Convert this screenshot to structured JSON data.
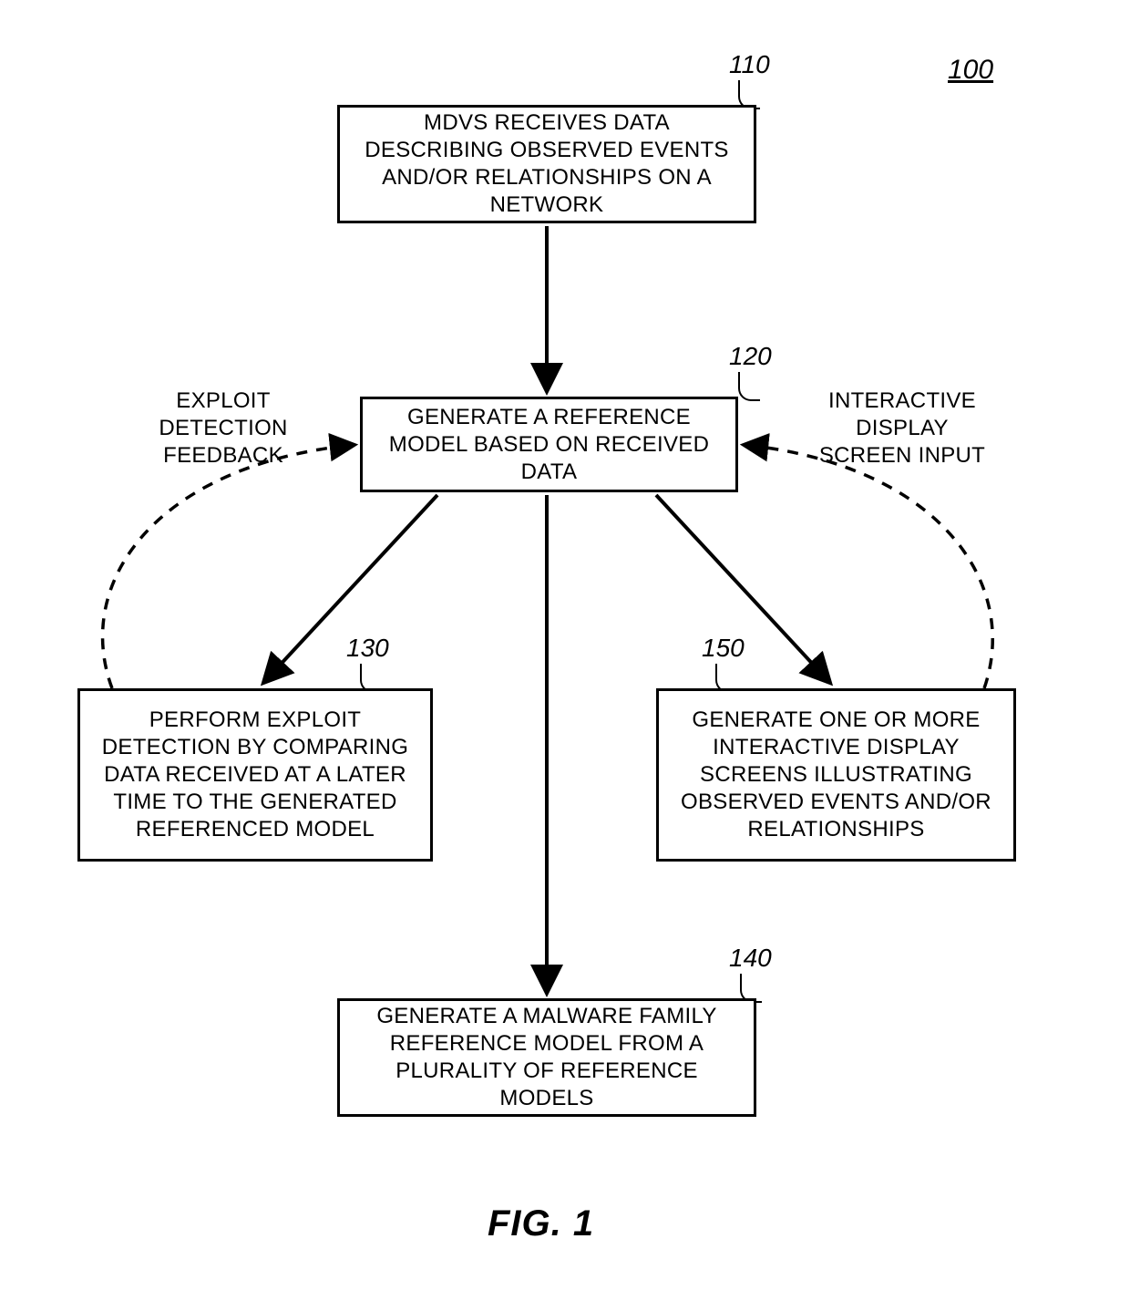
{
  "page_ref": "100",
  "figure_title": "FIG. 1",
  "feedback_left": "EXPLOIT DETECTION FEEDBACK",
  "feedback_right": "INTERACTIVE DISPLAY SCREEN INPUT",
  "boxes": {
    "b110": {
      "ref": "110",
      "text": "MDVS RECEIVES DATA DESCRIBING OBSERVED EVENTS AND/OR RELATIONSHIPS ON A NETWORK"
    },
    "b120": {
      "ref": "120",
      "text": "GENERATE A REFERENCE MODEL BASED ON RECEIVED DATA"
    },
    "b130": {
      "ref": "130",
      "text": "PERFORM EXPLOIT DETECTION BY COMPARING DATA RECEIVED AT A LATER TIME TO THE GENERATED REFERENCED MODEL"
    },
    "b140": {
      "ref": "140",
      "text": "GENERATE A MALWARE FAMILY REFERENCE MODEL FROM A PLURALITY OF REFERENCE MODELS"
    },
    "b150": {
      "ref": "150",
      "text": "GENERATE ONE OR MORE INTERACTIVE DISPLAY SCREENS ILLUSTRATING OBSERVED EVENTS AND/OR RELATIONSHIPS"
    }
  },
  "chart_data": {
    "type": "flowchart",
    "nodes": [
      {
        "id": "110",
        "label": "MDVS RECEIVES DATA DESCRIBING OBSERVED EVENTS AND/OR RELATIONSHIPS ON A NETWORK"
      },
      {
        "id": "120",
        "label": "GENERATE A REFERENCE MODEL BASED ON RECEIVED DATA"
      },
      {
        "id": "130",
        "label": "PERFORM EXPLOIT DETECTION BY COMPARING DATA RECEIVED AT A LATER TIME TO THE GENERATED REFERENCED MODEL"
      },
      {
        "id": "140",
        "label": "GENERATE A MALWARE FAMILY REFERENCE MODEL FROM A PLURALITY OF REFERENCE MODELS"
      },
      {
        "id": "150",
        "label": "GENERATE ONE OR MORE INTERACTIVE DISPLAY SCREENS ILLUSTRATING OBSERVED EVENTS AND/OR RELATIONSHIPS"
      }
    ],
    "edges": [
      {
        "from": "110",
        "to": "120",
        "style": "solid"
      },
      {
        "from": "120",
        "to": "130",
        "style": "solid"
      },
      {
        "from": "120",
        "to": "140",
        "style": "solid"
      },
      {
        "from": "120",
        "to": "150",
        "style": "solid"
      },
      {
        "from": "130",
        "to": "120",
        "style": "dashed",
        "label": "EXPLOIT DETECTION FEEDBACK"
      },
      {
        "from": "150",
        "to": "120",
        "style": "dashed",
        "label": "INTERACTIVE DISPLAY SCREEN INPUT"
      }
    ]
  }
}
